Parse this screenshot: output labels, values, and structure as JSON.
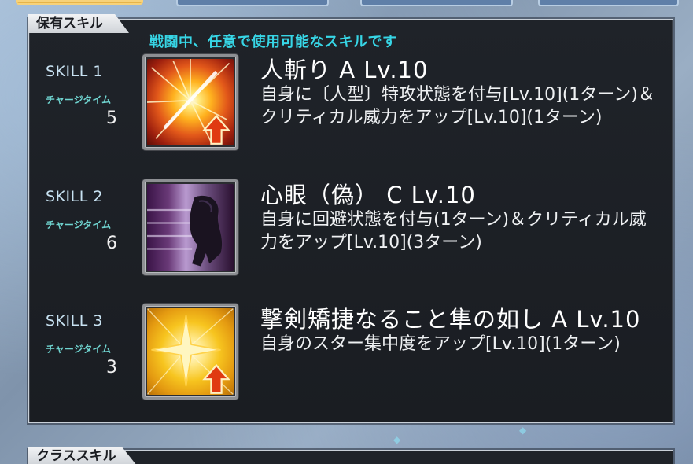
{
  "top_tabs": [
    "",
    "",
    "",
    ""
  ],
  "panel": {
    "label": "保有スキル",
    "subtitle": "戦闘中、任意で使用可能なスキルです"
  },
  "skills": [
    {
      "slot": "SKILL 1",
      "charge_label": "チャージタイム",
      "charge_value": "5",
      "icon": "slash-buff-icon",
      "name": "人斬り A Lv.10",
      "description": "自身に〔人型〕特攻状態を付与[Lv.10](1ターン)＆クリティカル威力をアップ[Lv.10](1ターン)"
    },
    {
      "slot": "SKILL 2",
      "charge_label": "チャージタイム",
      "charge_value": "6",
      "icon": "evade-dash-icon",
      "name": "心眼（偽） C Lv.10",
      "description": "自身に回避状態を付与(1ターン)＆クリティカル威力をアップ[Lv.10](3ターン)"
    },
    {
      "slot": "SKILL 3",
      "charge_label": "チャージタイム",
      "charge_value": "3",
      "icon": "star-buff-icon",
      "name": "撃剣矯捷なること隼の如し A Lv.10",
      "description": "自身のスター集中度をアップ[Lv.10](1ターン)"
    }
  ],
  "next_section": {
    "label": "クラススキル"
  },
  "colors": {
    "accent_cyan": "#37d6e6",
    "charge_label": "#6fd4d0",
    "panel_bg": "#1f2329"
  }
}
